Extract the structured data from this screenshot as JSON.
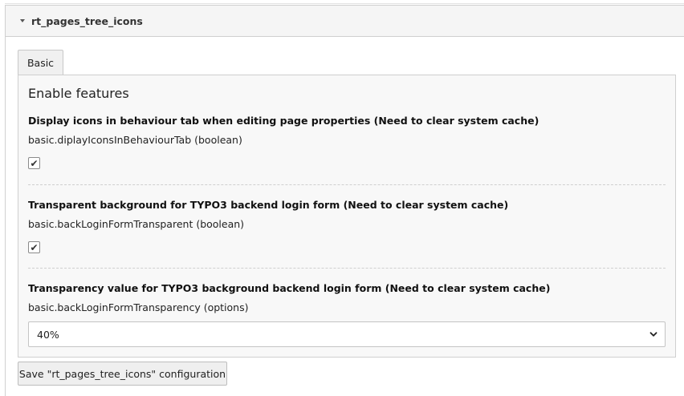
{
  "panel": {
    "title": "rt_pages_tree_icons"
  },
  "tabs": [
    {
      "label": "Basic"
    }
  ],
  "section": {
    "title": "Enable features"
  },
  "settings": [
    {
      "label": "Display icons in behaviour tab when editing page properties (Need to clear system cache)",
      "key": "basic.diplayIconsInBehaviourTab (boolean)",
      "checked": true
    },
    {
      "label": "Transparent background for TYPO3 backend login form (Need to clear system cache)",
      "key": "basic.backLoginFormTransparent (boolean)",
      "checked": true
    },
    {
      "label": "Transparency value for TYPO3 background backend login form (Need to clear system cache)",
      "key": "basic.backLoginFormTransparency (options)",
      "selected": "40%"
    }
  ],
  "save_button": {
    "label": "Save \"rt_pages_tree_icons\" configuration"
  },
  "icons": {
    "collapse": "caret-down-icon",
    "check": "checkmark-icon",
    "dropdown": "chevron-down-icon"
  },
  "colors": {
    "header_bg": "#f5f5f5",
    "content_bg": "#f8f8f8",
    "border": "#cfcfcf"
  }
}
